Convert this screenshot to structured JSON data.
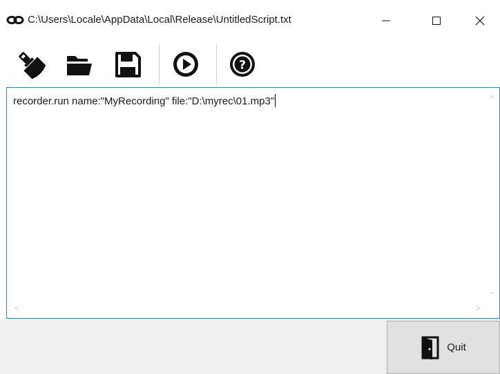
{
  "window": {
    "title": "C:\\Users\\Locale\\AppData\\Local\\Release\\UntitledScript.txt",
    "app_icon": "chain-link-icon"
  },
  "toolbar": {
    "buttons": [
      {
        "icon": "brush-icon"
      },
      {
        "icon": "folder-open-icon"
      },
      {
        "icon": "floppy-disk-icon"
      },
      {
        "icon": "play-icon"
      },
      {
        "icon": "help-icon"
      }
    ]
  },
  "editor": {
    "content": "recorder.run name:\"MyRecording\" file:\"D:\\myrec\\01.mp3\""
  },
  "footer": {
    "quit_label": "Quit",
    "quit_icon": "exit-door-icon"
  },
  "colors": {
    "editor_border": "#3c7fd0",
    "footer_bg": "#f0f0f0",
    "quit_button_bg": "#e1e1e1"
  }
}
